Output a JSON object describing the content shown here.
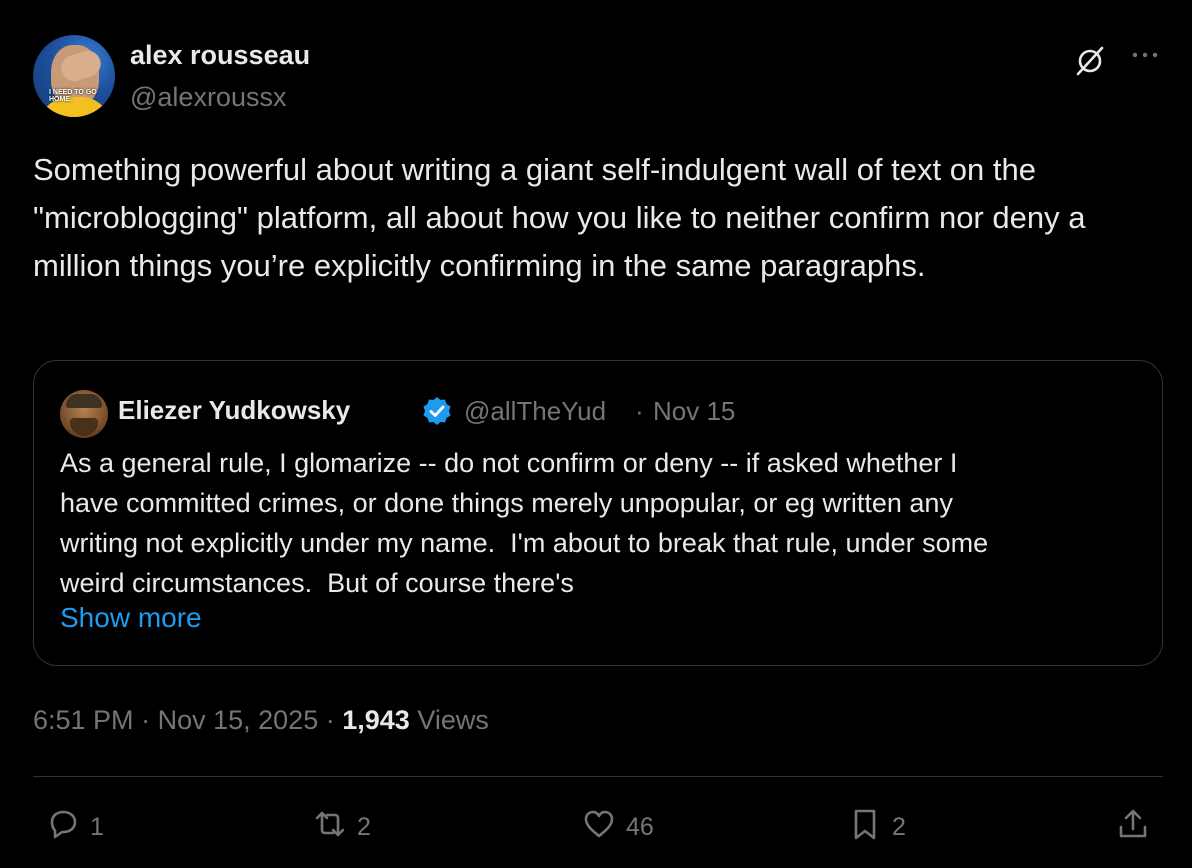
{
  "author": {
    "display_name": "alex rousseau",
    "handle": "@alexroussx",
    "avatar_caption": "I NEED TO GO HOME."
  },
  "tweet": {
    "text": "Something powerful about writing a giant self-indulgent wall of text on the \"microblogging\" platform, all about how you like to neither confirm nor deny a million things you’re explicitly confirming in the same paragraphs."
  },
  "quote": {
    "display_name": "Eliezer Yudkowsky",
    "handle": "@allTheYud",
    "separator": "·",
    "date": "Nov 15",
    "text": "As a general rule, I glomarize -- do not confirm or deny -- if asked whether I\nhave committed crimes, or done things merely unpopular, or eg written any\nwriting not explicitly under my name.  I'm about to break that rule, under some\nweird circumstances.  But of course there's",
    "show_more": "Show more"
  },
  "meta": {
    "time": "6:51 PM",
    "separator": "·",
    "date": "Nov 15, 2025",
    "views_count": "1,943",
    "views_label": "Views"
  },
  "actions": {
    "reply_count": "1",
    "repost_count": "2",
    "like_count": "46",
    "bookmark_count": "2"
  },
  "icons": [
    "grok-icon",
    "more-icon",
    "verified-icon",
    "reply-icon",
    "repost-icon",
    "like-icon",
    "bookmark-icon",
    "share-icon"
  ],
  "colors": {
    "background": "#000000",
    "text": "#e7e9ea",
    "muted": "#71767b",
    "accent": "#1d9bf0",
    "border": "#2f3336"
  }
}
